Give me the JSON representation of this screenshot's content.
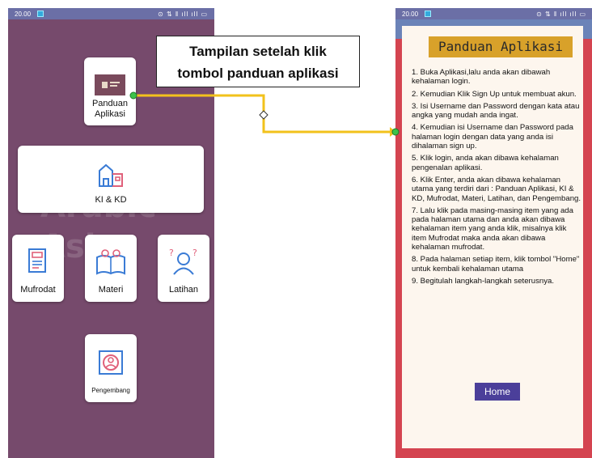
{
  "left_phone": {
    "status": {
      "time": "20.00",
      "icons": "⊙ ⇅ ‖ ıll ıll ▭"
    },
    "watermark": "Arabic Ask",
    "menu": [
      {
        "id": "panduan",
        "label": "Panduan\nAplikasi",
        "icon": "book-cover-icon"
      },
      {
        "id": "ki-kd",
        "label": "KI & KD",
        "icon": "school-building-icon"
      },
      {
        "id": "mufrodat",
        "label": "Mufrodat",
        "icon": "document-list-icon"
      },
      {
        "id": "materi",
        "label": "Materi",
        "icon": "open-book-icon"
      },
      {
        "id": "latihan",
        "label": "Latihan",
        "icon": "student-question-icon"
      },
      {
        "id": "pengembang",
        "label": "Pengembang",
        "icon": "profile-frame-icon"
      }
    ]
  },
  "callout": {
    "line1": "Tampilan setelah klik",
    "line2": "tombol panduan aplikasi"
  },
  "right_phone": {
    "status": {
      "time": "20.00",
      "icons": "⊙ ⇅ ‖ ıll ıll ▭"
    },
    "title": "Panduan Aplikasi",
    "steps": [
      "1. Buka Aplikasi,lalu anda akan dibawah kehalaman login.",
      "2. Kemudian Klik Sign Up untuk membuat akun.",
      "3. Isi Username dan Password dengan kata atau angka yang mudah anda ingat.",
      "4. Kemudian isi Username dan Password pada halaman login dengan data yang anda isi dihalaman sign up.",
      "5. Klik login, anda akan dibawa kehalaman pengenalan aplikasi.",
      "6. Klik Enter, anda akan dibawa kehalaman utama yang terdiri dari : Panduan Aplikasi, KI & KD, Mufrodat, Materi, Latihan, dan Pengembang.",
      "7. Lalu klik pada masing-masing item yang ada pada halaman utama dan anda akan dibawa kehalaman item yang anda klik, misalnya klik item Mufrodat maka anda akan dibawa kehalaman mufrodat.",
      "8. Pada halaman setiap item, klik tombol \"Home\" untuk kembali kehalaman utama",
      "9. Begitulah langkah-langkah seterusnya."
    ],
    "home_label": "Home"
  },
  "colors": {
    "left_bg": "#764a6c",
    "status_bar": "#6b6fa6",
    "right_bg": "#d44450",
    "title_bg": "#d8a12a",
    "home_bg": "#4b3f9a",
    "connector": "#f2c21b",
    "dot": "#3cc24a"
  }
}
